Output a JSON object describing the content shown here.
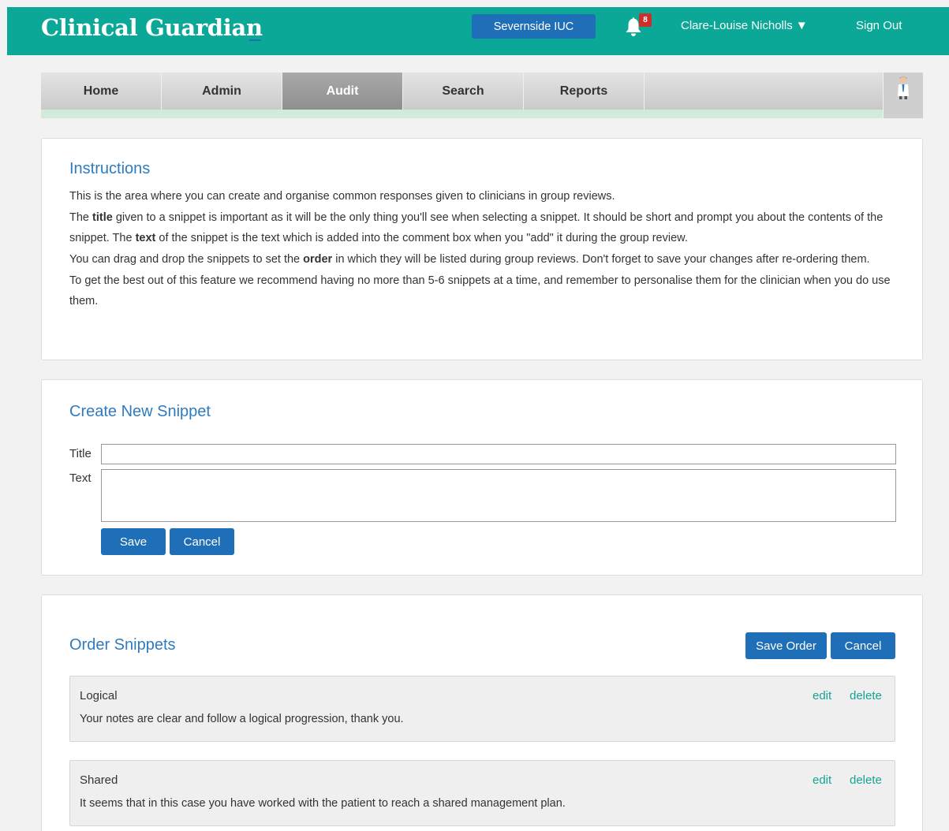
{
  "header": {
    "brand": "Clinical Guardian",
    "organisation": "Severnside IUC",
    "notification_count": "8",
    "user_menu": "Clare-Louise Nicholls ▼",
    "sign_out": "Sign Out"
  },
  "nav": {
    "tabs": [
      {
        "label": "Home",
        "active": false
      },
      {
        "label": "Admin",
        "active": false
      },
      {
        "label": "Audit",
        "active": true
      },
      {
        "label": "Search",
        "active": false
      },
      {
        "label": "Reports",
        "active": false
      }
    ]
  },
  "instructions": {
    "title": "Instructions",
    "p1": "This is the area where you can create and organise common responses given to clinicians in group reviews.",
    "p2_a": "The ",
    "p2_b": "title",
    "p2_c": " given to a snippet is important as it will be the only thing you'll see when selecting a snippet. It should be short and prompt you about the contents of the snippet. The ",
    "p2_d": "text",
    "p2_e": " of the snippet is the text which is added into the comment box when you \"add\" it during the group review.",
    "p3_a": "You can drag and drop the snippets to set the ",
    "p3_b": "order",
    "p3_c": " in which they will be listed during group reviews. Don't forget to save your changes after re-ordering them.",
    "p4": "To get the best out of this feature we recommend having no more than 5-6 snippets at a time, and remember to personalise them for the clinician when you do use them."
  },
  "create": {
    "title": "Create New Snippet",
    "title_label": "Title",
    "title_value": "",
    "text_label": "Text",
    "text_value": "",
    "save": "Save",
    "cancel": "Cancel"
  },
  "order": {
    "title": "Order Snippets",
    "save_order": "Save Order",
    "cancel": "Cancel",
    "edit": "edit",
    "delete": "delete",
    "snippets": [
      {
        "title": "Logical",
        "text": "Your notes are clear and follow a logical progression, thank you."
      },
      {
        "title": "Shared",
        "text": "It seems that in this case you have worked with the patient to reach a shared management plan."
      }
    ]
  },
  "colors": {
    "header_bg": "#0ba797",
    "primary_button": "#1f6fb8",
    "heading": "#2f7bbf",
    "link": "#16a394",
    "badge": "#c9302c"
  }
}
